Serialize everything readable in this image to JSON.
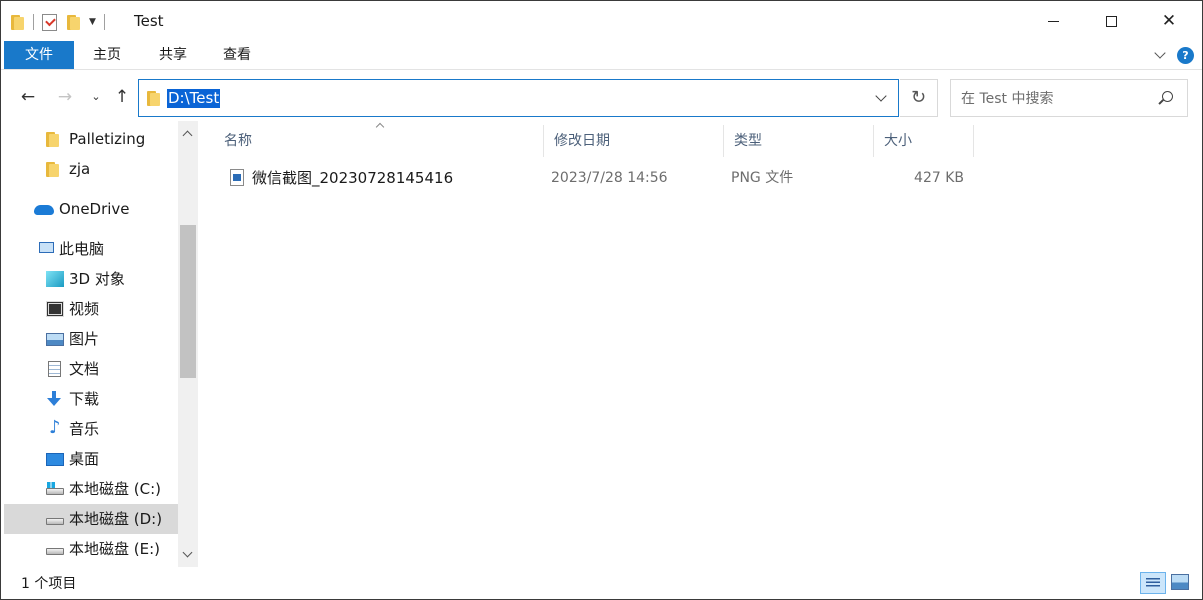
{
  "window": {
    "title": "Test",
    "controls": {
      "minimize": "minimize",
      "maximize": "maximize",
      "close": "✕"
    }
  },
  "ribbon": {
    "tabs": [
      {
        "label": "文件",
        "active": true
      },
      {
        "label": "主页"
      },
      {
        "label": "共享"
      },
      {
        "label": "查看"
      }
    ],
    "help_label": "?"
  },
  "navigation": {
    "back": "←",
    "forward": "→",
    "up": "↑",
    "recent": "⌄",
    "address": "D:\\Test",
    "refresh": "↻",
    "search_placeholder": "在 Test 中搜索"
  },
  "nav_pane": {
    "items": [
      {
        "label": "Palletizing",
        "icon": "folder-icon"
      },
      {
        "label": "zja",
        "icon": "folder-icon"
      },
      {
        "label": "OneDrive",
        "icon": "onedrive-icon"
      },
      {
        "label": "此电脑",
        "icon": "pc-icon"
      },
      {
        "label": "3D 对象",
        "icon": "3d-objects-icon"
      },
      {
        "label": "视频",
        "icon": "video-icon"
      },
      {
        "label": "图片",
        "icon": "pictures-icon"
      },
      {
        "label": "文档",
        "icon": "documents-icon"
      },
      {
        "label": "下载",
        "icon": "downloads-icon"
      },
      {
        "label": "音乐",
        "icon": "music-icon"
      },
      {
        "label": "桌面",
        "icon": "desktop-icon"
      },
      {
        "label": "本地磁盘 (C:)",
        "icon": "drive-c-icon"
      },
      {
        "label": "本地磁盘 (D:)",
        "icon": "drive-icon",
        "selected": true
      },
      {
        "label": "本地磁盘 (E:)",
        "icon": "drive-icon"
      }
    ],
    "music_glyph": "♪"
  },
  "content": {
    "columns": [
      "名称",
      "修改日期",
      "类型",
      "大小"
    ],
    "files": [
      {
        "name": "微信截图_20230728145416",
        "modified": "2023/7/28 14:56",
        "type": "PNG 文件",
        "size": "427 KB"
      }
    ]
  },
  "status": {
    "item_count": "1 个项目"
  },
  "colors": {
    "accent": "#1979ca",
    "selection": "#0a64d6",
    "header_text": "#4c607a"
  }
}
